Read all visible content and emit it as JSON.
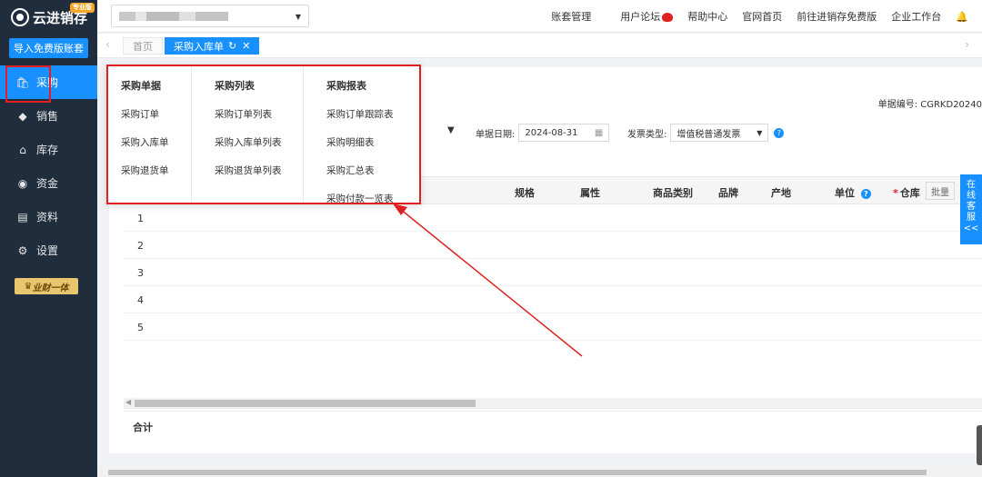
{
  "app": {
    "name": "云进销存",
    "edition_badge": "专业版",
    "import_button": "导入免费版账套"
  },
  "sidebar": {
    "items": [
      {
        "label": "采购",
        "icon": "bag-icon"
      },
      {
        "label": "销售",
        "icon": "sales-icon"
      },
      {
        "label": "库存",
        "icon": "warehouse-icon"
      },
      {
        "label": "资金",
        "icon": "money-icon"
      },
      {
        "label": "资料",
        "icon": "folder-icon"
      },
      {
        "label": "设置",
        "icon": "gear-icon"
      }
    ],
    "vip_badge": "业财一体"
  },
  "topbar": {
    "links": [
      "账套管理",
      "用户论坛",
      "帮助中心",
      "官网首页",
      "前往进销存免费版",
      "企业工作台"
    ]
  },
  "tabs": {
    "home": "首页",
    "current": "采购入库单"
  },
  "form": {
    "doc_number": "单据编号: CGRKD20240",
    "date_label": "单据日期:",
    "date_value": "2024-08-31",
    "invoice_label": "发票类型:",
    "invoice_value": "增值税普通发票"
  },
  "grid": {
    "columns": [
      "规格",
      "属性",
      "商品类别",
      "品牌",
      "产地",
      "单位",
      "仓库"
    ],
    "batch_button": "批量",
    "rows": [
      "1",
      "2",
      "3",
      "4",
      "5"
    ],
    "total_label": "合计"
  },
  "service_tab": [
    "在",
    "线",
    "客",
    "服",
    "<<"
  ],
  "menu": {
    "columns": [
      {
        "header": "采购单据",
        "items": [
          "采购订单",
          "采购入库单",
          "采购退货单"
        ]
      },
      {
        "header": "采购列表",
        "items": [
          "采购订单列表",
          "采购入库单列表",
          "采购退货单列表"
        ]
      },
      {
        "header": "采购报表",
        "items": [
          "采购订单跟踪表",
          "采购明细表",
          "采购汇总表",
          "采购付款一览表"
        ]
      }
    ]
  },
  "colors": {
    "sidebar_bg": "#1f2d3d",
    "accent": "#1890ff",
    "annotation_red": "#e02020"
  }
}
